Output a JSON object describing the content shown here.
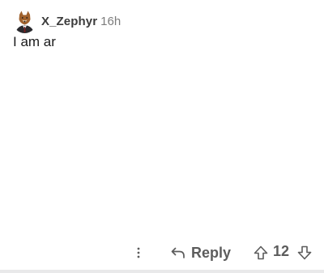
{
  "comment": {
    "author": "X_Zephyr",
    "age": "16h",
    "body": "I am ar",
    "avatar_icon": "fox-in-suit-avatar"
  },
  "actions": {
    "more_icon": "vertical-ellipsis-icon",
    "reply_icon": "reply-arrow-icon",
    "reply_label": "Reply",
    "upvote_icon": "upvote-arrow-icon",
    "score": "12",
    "downvote_icon": "downvote-arrow-icon"
  },
  "colors": {
    "text_primary": "#1a1a1b",
    "text_secondary": "#7c7c7c",
    "action_gray": "#5c5c5c",
    "divider": "#e9e9ea"
  }
}
